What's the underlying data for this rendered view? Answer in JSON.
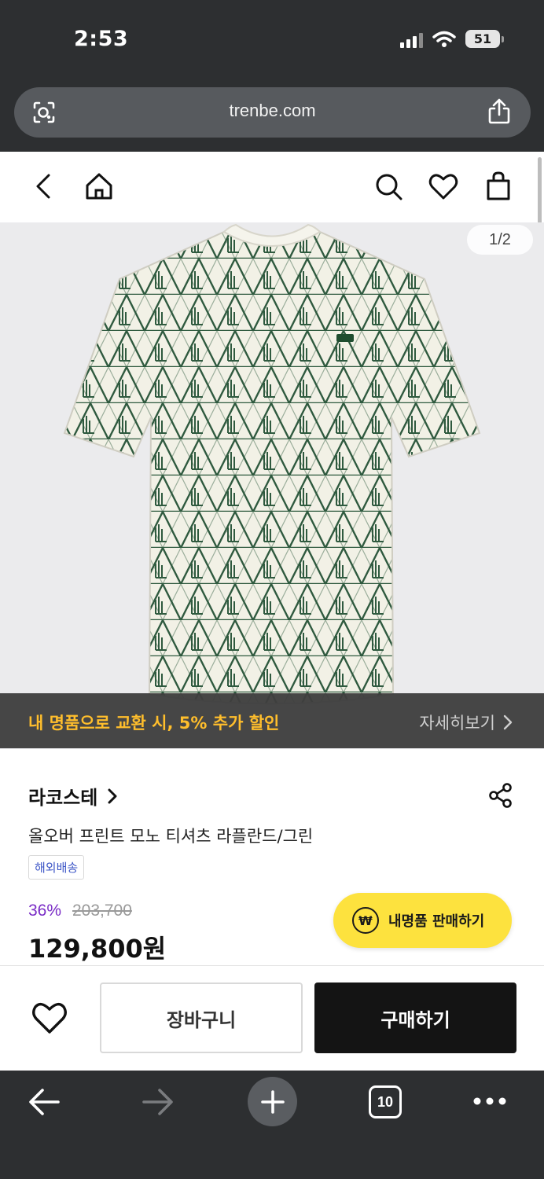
{
  "status_bar": {
    "time": "2:53",
    "battery": "51"
  },
  "browser": {
    "url": "trenbe.com",
    "tab_count": "10"
  },
  "app_header": {
    "icons": [
      "back-icon",
      "home-icon",
      "search-icon",
      "heart-icon",
      "shopping-bag-icon"
    ]
  },
  "product_image": {
    "counter": "1/2",
    "description_icon": "t-shirt-image",
    "pattern_color": "#2f5a3f"
  },
  "promo": {
    "text": "내 명품으로 교환 시, 5% 추가 할인",
    "link_label": "자세히보기",
    "text_color": "#ffbe2c"
  },
  "product": {
    "brand": "라코스테",
    "name": "올오버 프린트 모노 티셔츠 라플란드/그린",
    "tag": "해외배송",
    "discount": "36%",
    "original_price": "203,700",
    "price": "129,800원"
  },
  "sell_button": {
    "label": "내명품 판매하기",
    "icon_glyph": "₩",
    "color": "#fde23e"
  },
  "actions": {
    "cart_label": "장바구니",
    "buy_label": "구매하기"
  }
}
